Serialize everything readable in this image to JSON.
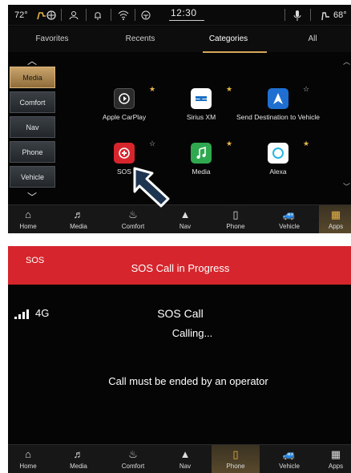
{
  "status_bar": {
    "outside_temp": "72°",
    "clock": "12:30",
    "cabin_temp": "68°"
  },
  "tabs": [
    {
      "label": "Favorites",
      "active": false
    },
    {
      "label": "Recents",
      "active": false
    },
    {
      "label": "Categories",
      "active": true
    },
    {
      "label": "All",
      "active": false
    }
  ],
  "side_menu": [
    {
      "label": "Media",
      "active": true
    },
    {
      "label": "Comfort",
      "active": false
    },
    {
      "label": "Nav",
      "active": false
    },
    {
      "label": "Phone",
      "active": false
    },
    {
      "label": "Vehicle",
      "active": false
    }
  ],
  "apps": [
    {
      "label": "Apple CarPlay",
      "icon": "carplay-icon",
      "star": "gold",
      "color": "#2b2b2b"
    },
    {
      "label": "Sirius XM",
      "icon": "siriusxm-icon",
      "star": "gold",
      "color": "#ffffff"
    },
    {
      "label": "Send Destination to Vehicle",
      "icon": "navigation-arrow-icon",
      "star": "outline",
      "color": "#1f6fd1"
    },
    {
      "label": "SOS",
      "icon": "sos-icon",
      "star": "outline",
      "color": "#d6252c"
    },
    {
      "label": "Media",
      "icon": "music-note-icon",
      "star": "gold",
      "color": "#2fa84f"
    },
    {
      "label": "Alexa",
      "icon": "alexa-icon",
      "star": "gold",
      "color": "#ffffff"
    }
  ],
  "nav": [
    {
      "label": "Home",
      "icon": "home-icon"
    },
    {
      "label": "Media",
      "icon": "music-note-icon"
    },
    {
      "label": "Comfort",
      "icon": "seat-heat-icon"
    },
    {
      "label": "Nav",
      "icon": "nav-arrow-icon"
    },
    {
      "label": "Phone",
      "icon": "phone-icon"
    },
    {
      "label": "Vehicle",
      "icon": "car-icon"
    },
    {
      "label": "Apps",
      "icon": "apps-grid-icon"
    }
  ],
  "nav_active_top": "Apps",
  "nav_active_bottom": "Phone",
  "sos_screen": {
    "tag": "SOS",
    "title": "SOS Call in Progress",
    "signal": "4G",
    "call_title": "SOS Call",
    "call_status": "Calling...",
    "message": "Call must be ended by an operator"
  },
  "colors": {
    "accent_gold": "#d6a85a",
    "sos_red": "#d6252c",
    "star_gold": "#e9b646"
  }
}
